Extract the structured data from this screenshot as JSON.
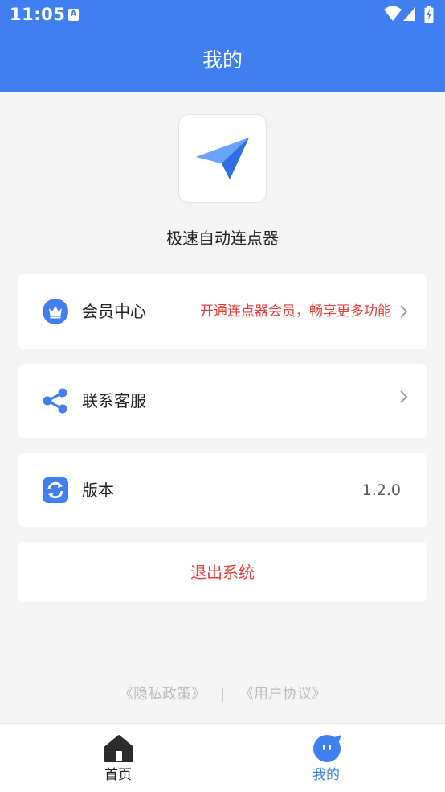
{
  "status_bar": {
    "time": "11:05",
    "notification_icon": "a-letter-icon",
    "icons": [
      "wifi-icon",
      "signal-icon",
      "battery-charging-icon"
    ]
  },
  "header": {
    "title": "我的"
  },
  "app": {
    "name": "极速自动连点器",
    "logo_icon": "paper-plane-icon"
  },
  "menu": {
    "vip": {
      "label": "会员中心",
      "promo": "开通连点器会员，畅享更多功能",
      "icon": "crown-icon"
    },
    "support": {
      "label": "联系客服",
      "icon": "share-icon"
    },
    "version": {
      "label": "版本",
      "value": "1.2.0",
      "icon": "refresh-icon"
    }
  },
  "logout": {
    "label": "退出系统"
  },
  "footer_links": {
    "privacy": "《隐私政策》",
    "separator": "|",
    "agreement": "《用户协议》"
  },
  "bottom_nav": {
    "home": {
      "label": "首页",
      "icon": "home-icon"
    },
    "mine": {
      "label": "我的",
      "icon": "chat-face-icon",
      "active": true
    }
  },
  "colors": {
    "brand": "#3f7ff0",
    "danger": "#e8403a",
    "background": "#f4f4f4",
    "muted": "#bdbdbd"
  }
}
